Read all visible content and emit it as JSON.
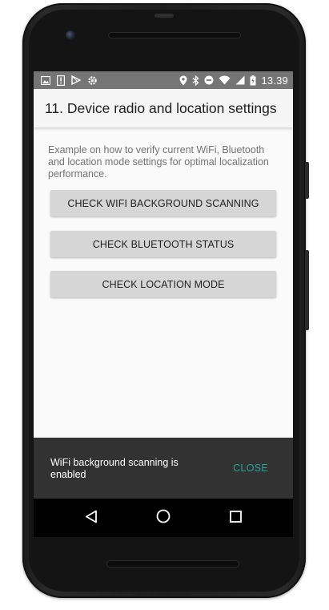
{
  "status_bar": {
    "time": "13.39",
    "left_icons": [
      "image-icon",
      "sim-alert-icon",
      "play-store-icon",
      "settings-gear-icon"
    ],
    "right_icons": [
      "location-icon",
      "bluetooth-icon",
      "do-not-disturb-icon",
      "wifi-icon",
      "signal-icon",
      "battery-charging-icon"
    ]
  },
  "app_bar": {
    "title": "11. Device radio and location settings"
  },
  "content": {
    "description": "Example on how to verify current WiFi, Bluetooth and location mode settings for optimal localization performance.",
    "buttons": [
      {
        "label": "CHECK WIFI BACKGROUND SCANNING"
      },
      {
        "label": "CHECK BLUETOOTH STATUS"
      },
      {
        "label": "CHECK LOCATION MODE"
      }
    ]
  },
  "snackbar": {
    "message": "WiFi background scanning is enabled",
    "action": "CLOSE",
    "action_color": "#26a69a"
  },
  "nav_bar": {
    "icons": [
      "back-icon",
      "home-icon",
      "recents-icon"
    ]
  },
  "colors": {
    "status_bar": "#757575",
    "app_bar": "#f5f5f5",
    "button": "#d6d6d6",
    "snackbar": "#323232"
  }
}
